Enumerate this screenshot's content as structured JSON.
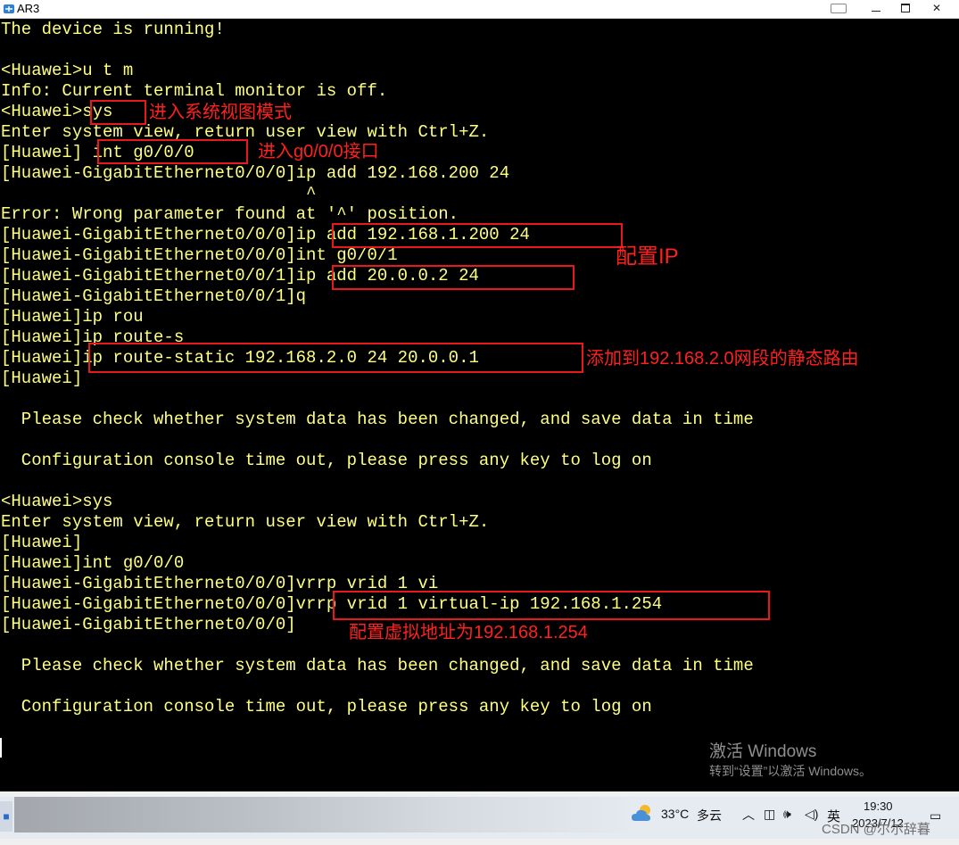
{
  "window": {
    "title": "AR3",
    "accent": "#1b6ac9"
  },
  "terminal": {
    "text_color": "#ffff80",
    "lines": [
      "The device is running!",
      "",
      "<Huawei>u t m",
      "Info: Current terminal monitor is off.",
      "<Huawei>sys",
      "Enter system view, return user view with Ctrl+Z.",
      "[Huawei] int g0/0/0",
      "[Huawei-GigabitEthernet0/0/0]ip add 192.168.200 24",
      "                              ^",
      "Error: Wrong parameter found at '^' position.",
      "[Huawei-GigabitEthernet0/0/0]ip add 192.168.1.200 24",
      "[Huawei-GigabitEthernet0/0/0]int g0/0/1",
      "[Huawei-GigabitEthernet0/0/1]ip add 20.0.0.2 24",
      "[Huawei-GigabitEthernet0/0/1]q",
      "[Huawei]ip rou",
      "[Huawei]ip route-s",
      "[Huawei]ip route-static 192.168.2.0 24 20.0.0.1",
      "[Huawei]",
      "",
      "  Please check whether system data has been changed, and save data in time",
      "",
      "  Configuration console time out, please press any key to log on",
      "",
      "<Huawei>sys",
      "Enter system view, return user view with Ctrl+Z.",
      "[Huawei]",
      "[Huawei]int g0/0/0",
      "[Huawei-GigabitEthernet0/0/0]vrrp vrid 1 vi",
      "[Huawei-GigabitEthernet0/0/0]vrrp vrid 1 virtual-ip 192.168.1.254",
      "[Huawei-GigabitEthernet0/0/0]",
      "",
      "  Please check whether system data has been changed, and save data in time",
      "",
      "  Configuration console time out, please press any key to log on"
    ]
  },
  "annotations": {
    "color": "#e8191c",
    "sys_mode": "进入系统视图模式",
    "enter_interface": "进入g0/0/0接口",
    "config_ip": "配置IP",
    "static_route": "添加到192.168.2.0网段的静态路由",
    "virtual_ip": "配置虚拟地址为192.168.1.254"
  },
  "watermark": {
    "line1": "激活 Windows",
    "line2": "转到“设置”以激活 Windows。"
  },
  "taskbar": {
    "weather_temp": "33°C",
    "weather_desc": "多云",
    "ime": "英",
    "time": "19:30",
    "date": "2023/7/12",
    "csdn": "CSDN @尔尔辞暮"
  }
}
